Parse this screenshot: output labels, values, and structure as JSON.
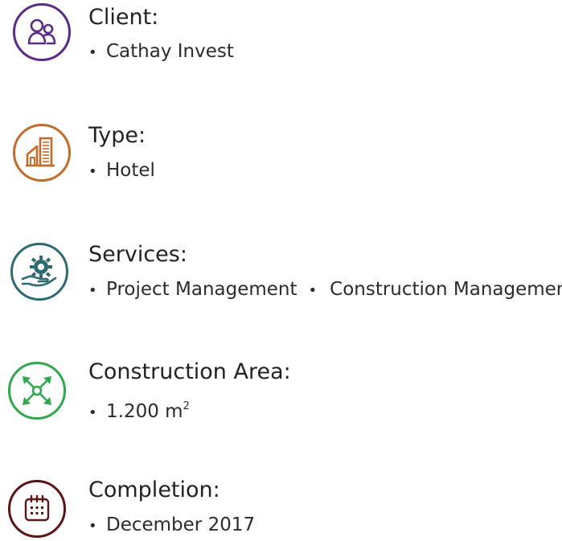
{
  "colors": {
    "client": "#5b2b86",
    "type": "#c26b2a",
    "services": "#2f6a73",
    "area": "#2fa84f",
    "completion": "#5c1414"
  },
  "client": {
    "icon": "people-icon",
    "label": "Client:",
    "value": "Cathay Invest"
  },
  "type": {
    "icon": "building-icon",
    "label": "Type:",
    "value": "Hotel"
  },
  "services": {
    "icon": "gear-hand-icon",
    "label": "Services:",
    "items": [
      "Project Management",
      "Construction Managemen"
    ]
  },
  "area": {
    "icon": "expand-arrows-icon",
    "label": "Construction Area:",
    "value": "1.200 m",
    "unit_sup": "2"
  },
  "completion": {
    "icon": "calendar-icon",
    "label": "Completion:",
    "value": "December 2017"
  },
  "bullet": "•"
}
